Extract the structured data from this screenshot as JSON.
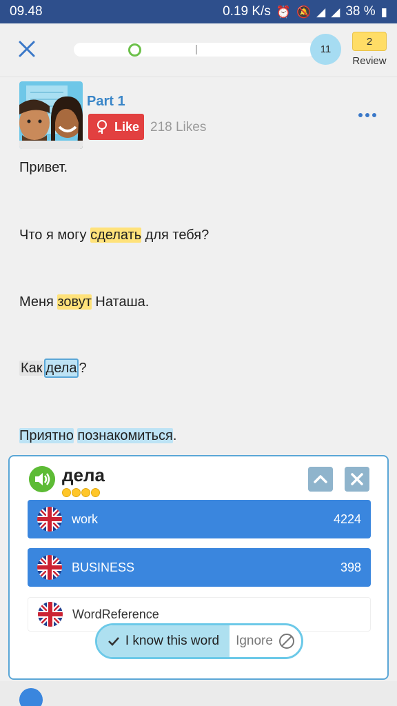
{
  "status_bar": {
    "time": "09.48",
    "network_speed": "0.19 K/s",
    "battery": "38 %",
    "icons": [
      "alarm-icon",
      "mute-icon",
      "signal-icon",
      "battery-icon"
    ]
  },
  "top_bar": {
    "close_icon": "close-icon",
    "progress": 0.25,
    "count": "11",
    "review_count": "2",
    "review_label": "Review"
  },
  "lesson": {
    "part_title": "Part 1",
    "like_label": "Like",
    "likes": "218 Likes",
    "lines": {
      "l1": "Привет.",
      "l2a": "Что я могу ",
      "l2b": "сделать",
      "l2c": " для тебя?",
      "l3a": "Меня ",
      "l3b": "зовут",
      "l3c": " Наташа.",
      "l4a": "Как",
      "l4b": "дела",
      "l4c": "?",
      "l5a": "Приятно",
      "l5b": "познакомиться",
      "l5c": "."
    }
  },
  "popup": {
    "word": "дела",
    "level": 4,
    "translations": [
      {
        "label": "work",
        "count": "4224"
      },
      {
        "label": "BUSINESS",
        "count": "398"
      }
    ],
    "reference": "WordReference",
    "know_label": "I know this word",
    "ignore_label": "Ignore"
  },
  "colors": {
    "status_bar": "#2e4f8c",
    "accent_blue": "#3a86de",
    "highlight_yellow": "#ffe27a",
    "highlight_blue": "#bde3f5",
    "like_red": "#e24040"
  }
}
